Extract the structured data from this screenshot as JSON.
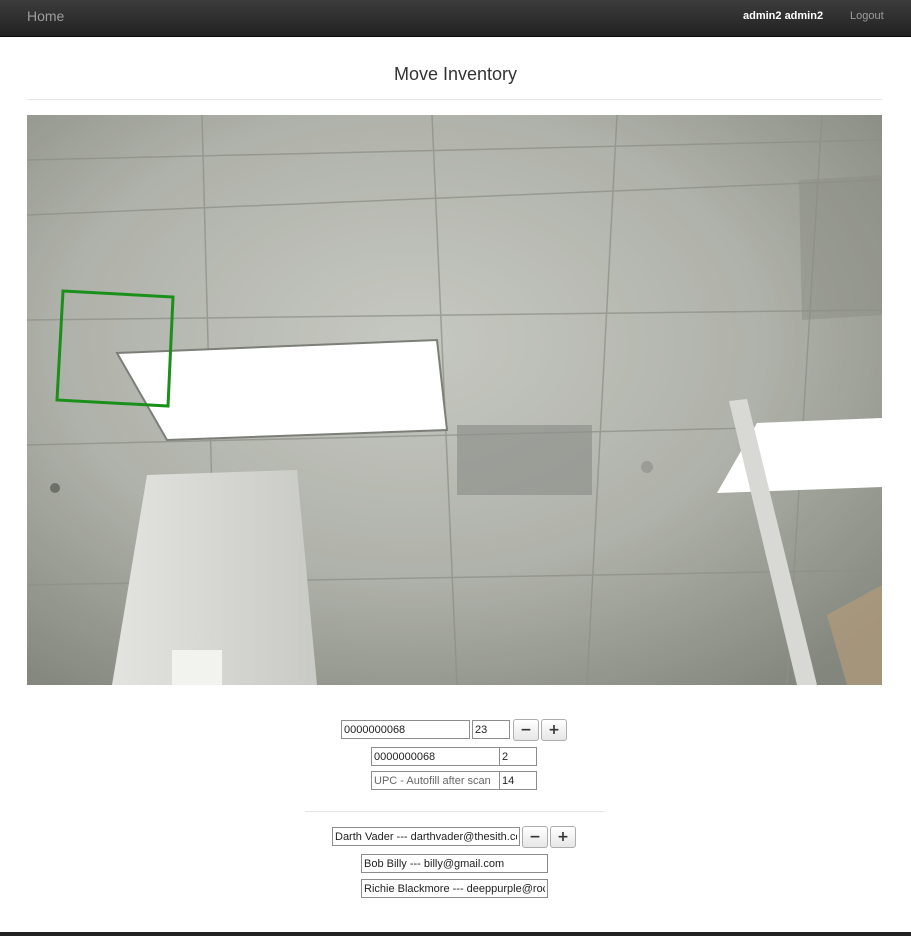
{
  "nav": {
    "home_label": "Home",
    "user_name": "admin2 admin2",
    "logout_label": "Logout"
  },
  "page": {
    "title": "Move Inventory"
  },
  "inventory": {
    "rows": [
      {
        "upc": "0000000068",
        "qty": "23"
      },
      {
        "upc": "0000000068",
        "qty": "2"
      },
      {
        "upc": "",
        "upc_placeholder": "UPC - Autofill after scan",
        "qty": "14"
      }
    ],
    "minus_label": "−",
    "plus_label": "+"
  },
  "users": {
    "rows": [
      "Darth Vader --- darthvader@thesith.com",
      "Bob Billy --- billy@gmail.com",
      "Richie Blackmore --- deeppurple@rock.com"
    ],
    "minus_label": "−",
    "plus_label": "+"
  },
  "colors": {
    "navbar": "#222222",
    "scan_box": "#1a8f1a"
  }
}
